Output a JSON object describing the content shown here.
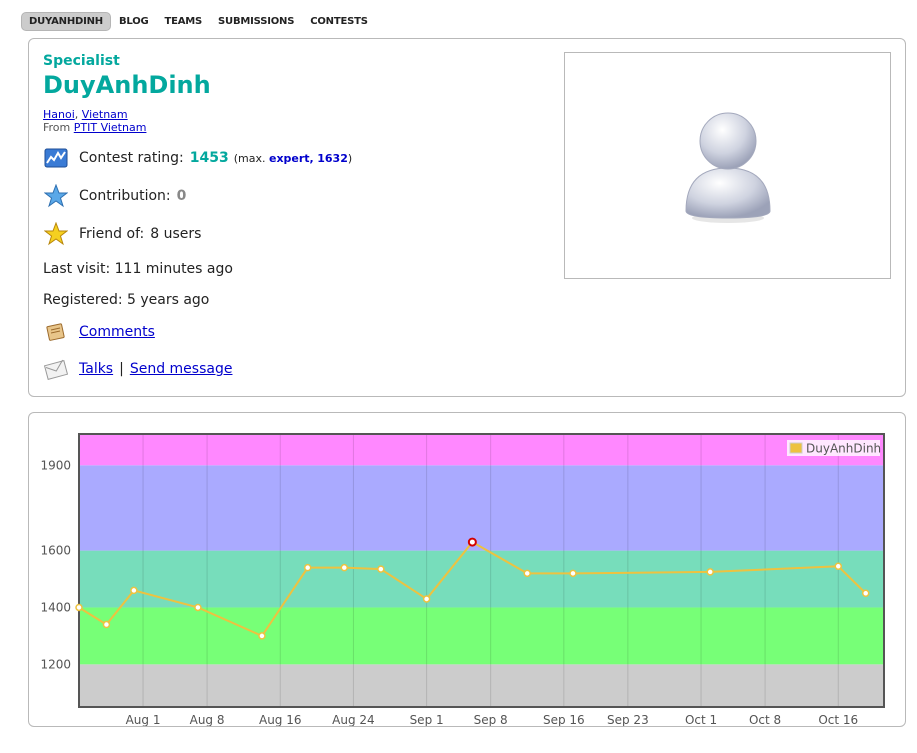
{
  "tabs": [
    {
      "label": "DUYANHDINH",
      "active": true
    },
    {
      "label": "BLOG",
      "active": false
    },
    {
      "label": "TEAMS",
      "active": false
    },
    {
      "label": "SUBMISSIONS",
      "active": false
    },
    {
      "label": "CONTESTS",
      "active": false
    }
  ],
  "profile": {
    "rank": "Specialist",
    "handle": "DuyAnhDinh",
    "city": "Hanoi",
    "country": "Vietnam",
    "from_label": "From",
    "organization": "PTIT Vietnam",
    "rating_label": "Contest rating:",
    "rating": "1453",
    "max_prefix": "(max.",
    "max_rank": "expert,",
    "max_rating": "1632",
    "max_suffix": ")",
    "contribution_label": "Contribution:",
    "contribution": "0",
    "friend_label": "Friend of:",
    "friend_value": "8 users",
    "last_visit": "Last visit: 111 minutes ago",
    "registered": "Registered: 5 years ago",
    "comments_link": "Comments",
    "talks_link": "Talks",
    "separator": "|",
    "send_message_link": "Send message"
  },
  "colors": {
    "rank": "#03a89e",
    "link": "#0000cc"
  },
  "chart_data": {
    "type": "line",
    "title": "",
    "xlabel": "",
    "ylabel": "",
    "ylim": [
      1050,
      2010
    ],
    "y_ticks": [
      1200,
      1400,
      1600,
      1900
    ],
    "x_ticks": [
      "Aug 1",
      "Aug 8",
      "Aug 16",
      "Aug 24",
      "Sep 1",
      "Sep 8",
      "Sep 16",
      "Sep 23",
      "Oct 1",
      "Oct 8",
      "Oct 16"
    ],
    "x_tick_days": [
      1,
      8,
      16,
      24,
      32,
      39,
      47,
      54,
      62,
      69,
      77
    ],
    "xlim": [
      -6,
      82
    ],
    "bands": [
      {
        "from": 1050,
        "to": 1200,
        "color": "#cccccc"
      },
      {
        "from": 1200,
        "to": 1400,
        "color": "#77ff77"
      },
      {
        "from": 1400,
        "to": 1600,
        "color": "#77ddbb"
      },
      {
        "from": 1600,
        "to": 1900,
        "color": "#aaaaff"
      },
      {
        "from": 1900,
        "to": 2010,
        "color": "#ff88ff"
      }
    ],
    "legend_position": "top-right",
    "grid": true,
    "series": [
      {
        "name": "DuyAnhDinh",
        "color": "#edc240",
        "x": [
          -6,
          -3,
          0,
          7,
          14,
          19,
          23,
          27,
          32,
          37,
          43,
          48,
          63,
          77,
          80
        ],
        "y": [
          1400,
          1340,
          1460,
          1400,
          1300,
          1540,
          1540,
          1535,
          1430,
          1630,
          1520,
          1520,
          1525,
          1545,
          1450
        ]
      }
    ]
  }
}
